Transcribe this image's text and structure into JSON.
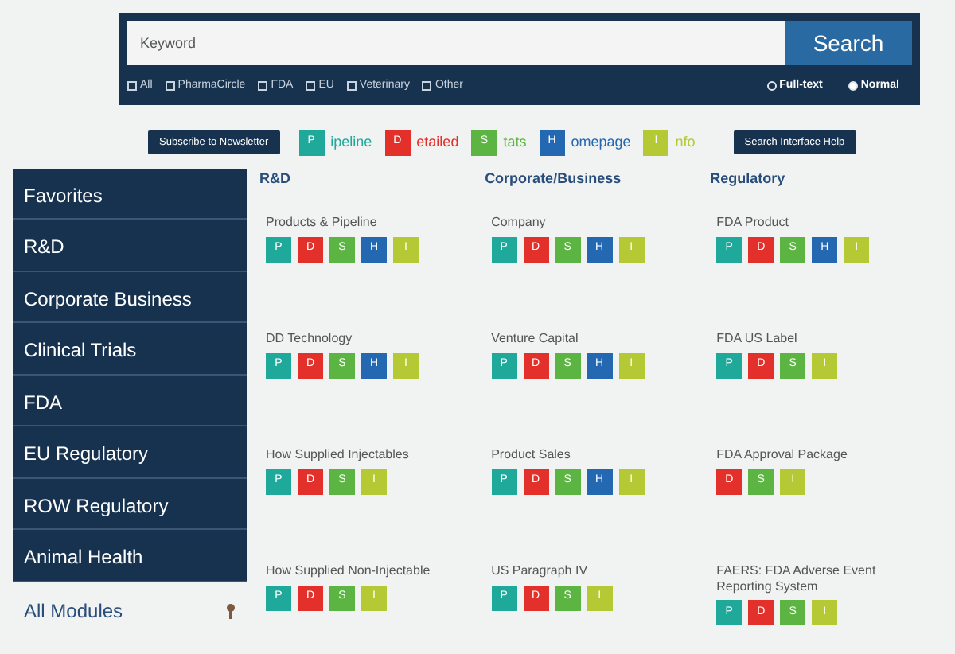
{
  "search": {
    "placeholder": "Keyword",
    "button": "Search",
    "filters": [
      {
        "label": "All",
        "checked": false
      },
      {
        "label": "PharmaCircle",
        "checked": false
      },
      {
        "label": "FDA",
        "checked": false
      },
      {
        "label": "EU",
        "checked": false
      },
      {
        "label": "Veterinary",
        "checked": false
      },
      {
        "label": "Other",
        "checked": false
      }
    ],
    "modes": [
      {
        "label": "Full-text",
        "selected": false
      },
      {
        "label": "Normal",
        "selected": true
      }
    ]
  },
  "subscribe_button": "Subscribe to Newsletter",
  "legend": [
    {
      "letter": "P",
      "rest": "ipeline",
      "kind": "p"
    },
    {
      "letter": "D",
      "rest": "etailed",
      "kind": "d"
    },
    {
      "letter": "S",
      "rest": "tats",
      "kind": "s"
    },
    {
      "letter": "H",
      "rest": "omepage",
      "kind": "h"
    },
    {
      "letter": "I",
      "rest": "nfo",
      "kind": "i"
    }
  ],
  "help_button": "Search Interface Help",
  "sidebar": {
    "items": [
      "Favorites",
      "R&D",
      "Corporate Business",
      "Clinical Trials",
      "FDA",
      "EU Regulatory",
      "ROW Regulatory",
      "Animal Health"
    ],
    "all_modules": "All Modules"
  },
  "columns": [
    {
      "title": "R&D",
      "modules": [
        {
          "name": "Products & Pipeline",
          "tiles": [
            {
              "letter": "P",
              "kind": "p"
            },
            {
              "letter": "D",
              "kind": "d"
            },
            {
              "letter": "S",
              "kind": "s"
            },
            {
              "letter": "H",
              "kind": "h"
            },
            {
              "letter": "I",
              "kind": "i"
            }
          ]
        },
        {
          "name": "DD Technology",
          "tiles": [
            {
              "letter": "P",
              "kind": "p"
            },
            {
              "letter": "D",
              "kind": "d"
            },
            {
              "letter": "S",
              "kind": "s"
            },
            {
              "letter": "H",
              "kind": "h"
            },
            {
              "letter": "I",
              "kind": "i"
            }
          ]
        },
        {
          "name": "How Supplied Injectables",
          "tiles": [
            {
              "letter": "P",
              "kind": "p"
            },
            {
              "letter": "D",
              "kind": "d"
            },
            {
              "letter": "S",
              "kind": "s"
            },
            {
              "letter": "I",
              "kind": "i"
            }
          ]
        },
        {
          "name": "How Supplied Non-Injectable",
          "tiles": [
            {
              "letter": "P",
              "kind": "p"
            },
            {
              "letter": "D",
              "kind": "d"
            },
            {
              "letter": "S",
              "kind": "s"
            },
            {
              "letter": "I",
              "kind": "i"
            }
          ]
        }
      ]
    },
    {
      "title": "Corporate/Business",
      "modules": [
        {
          "name": "Company",
          "tiles": [
            {
              "letter": "P",
              "kind": "p"
            },
            {
              "letter": "D",
              "kind": "d"
            },
            {
              "letter": "S",
              "kind": "s"
            },
            {
              "letter": "H",
              "kind": "h"
            },
            {
              "letter": "I",
              "kind": "i"
            }
          ]
        },
        {
          "name": "Venture Capital",
          "tiles": [
            {
              "letter": "P",
              "kind": "p"
            },
            {
              "letter": "D",
              "kind": "d"
            },
            {
              "letter": "S",
              "kind": "s"
            },
            {
              "letter": "H",
              "kind": "h"
            },
            {
              "letter": "I",
              "kind": "i"
            }
          ]
        },
        {
          "name": "Product Sales",
          "tiles": [
            {
              "letter": "P",
              "kind": "p"
            },
            {
              "letter": "D",
              "kind": "d"
            },
            {
              "letter": "S",
              "kind": "s"
            },
            {
              "letter": "H",
              "kind": "h"
            },
            {
              "letter": "I",
              "kind": "i"
            }
          ]
        },
        {
          "name": "US Paragraph IV",
          "tiles": [
            {
              "letter": "P",
              "kind": "p"
            },
            {
              "letter": "D",
              "kind": "d"
            },
            {
              "letter": "S",
              "kind": "s"
            },
            {
              "letter": "I",
              "kind": "i"
            }
          ]
        }
      ]
    },
    {
      "title": "Regulatory",
      "modules": [
        {
          "name": "FDA Product",
          "tiles": [
            {
              "letter": "P",
              "kind": "p"
            },
            {
              "letter": "D",
              "kind": "d"
            },
            {
              "letter": "S",
              "kind": "s"
            },
            {
              "letter": "H",
              "kind": "h"
            },
            {
              "letter": "I",
              "kind": "i"
            }
          ]
        },
        {
          "name": "FDA US Label",
          "tiles": [
            {
              "letter": "P",
              "kind": "p"
            },
            {
              "letter": "D",
              "kind": "d"
            },
            {
              "letter": "S",
              "kind": "s"
            },
            {
              "letter": "I",
              "kind": "i"
            }
          ]
        },
        {
          "name": "FDA Approval Package",
          "tiles": [
            {
              "letter": "D",
              "kind": "d"
            },
            {
              "letter": "S",
              "kind": "s"
            },
            {
              "letter": "I",
              "kind": "i"
            }
          ]
        },
        {
          "name": "FAERS: FDA Adverse Event Reporting System",
          "tiles": [
            {
              "letter": "P",
              "kind": "p"
            },
            {
              "letter": "D",
              "kind": "d"
            },
            {
              "letter": "S",
              "kind": "s"
            },
            {
              "letter": "I",
              "kind": "i"
            }
          ]
        }
      ]
    }
  ]
}
